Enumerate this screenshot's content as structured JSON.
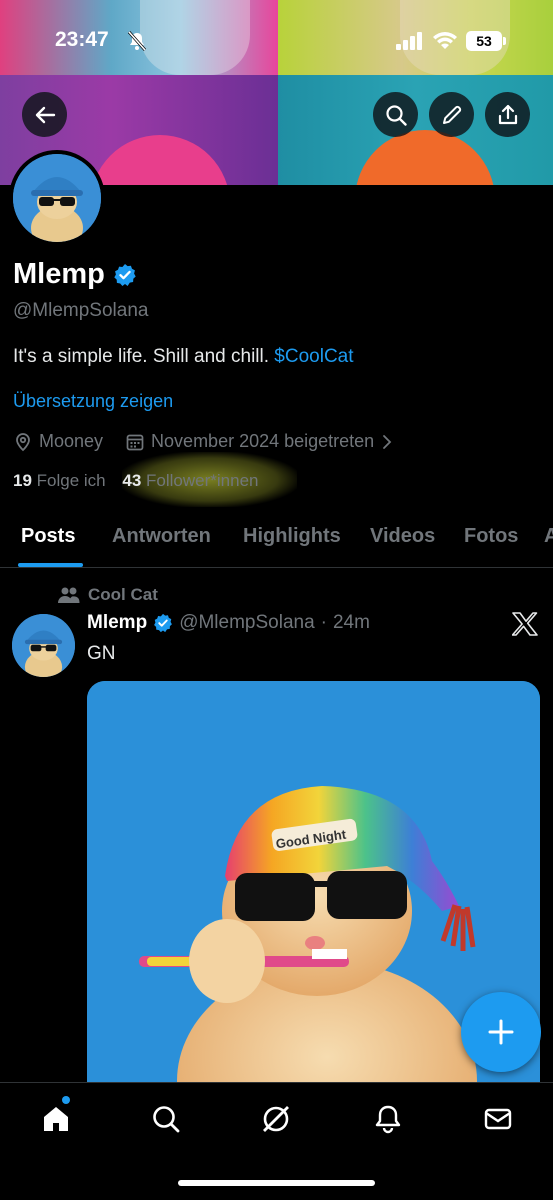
{
  "status_bar": {
    "time": "23:47",
    "battery": "53"
  },
  "profile": {
    "name": "Mlemp",
    "handle": "@MlempSolana",
    "bio_text": "It's a simple life. Shill and chill.",
    "bio_tag": "$CoolCat",
    "translate_label": "Übersetzung zeigen",
    "location": "Mooney",
    "joined": "November 2024 beigetreten",
    "following_count": "19",
    "following_label": "Folge ich",
    "followers_count": "43",
    "followers_label": "Follower*innen"
  },
  "tabs": [
    {
      "label": "Posts"
    },
    {
      "label": "Antworten"
    },
    {
      "label": "Highlights"
    },
    {
      "label": "Videos"
    },
    {
      "label": "Fotos"
    },
    {
      "label": "A"
    }
  ],
  "post": {
    "pinned_label": "Cool Cat",
    "author": "Mlemp",
    "handle": "@MlempSolana",
    "separator": "·",
    "time": "24m",
    "text": "GN",
    "image_hat_text": "Good Night"
  },
  "icons": {
    "back": "arrow-left-icon",
    "search": "search-icon",
    "edit": "pencil-icon",
    "share": "share-icon",
    "verified": "verified-badge-icon",
    "location": "location-pin-icon",
    "calendar": "calendar-icon",
    "fab": "plus-icon"
  },
  "colors": {
    "accent": "#1d9bf0",
    "background": "#000000",
    "muted": "#71767b"
  }
}
